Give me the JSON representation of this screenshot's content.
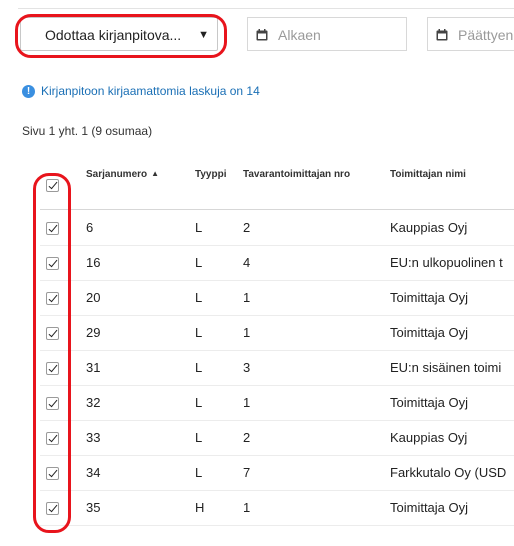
{
  "filters": {
    "status_value": "Odottaa kirjanpitova...",
    "start_placeholder": "Alkaen",
    "end_placeholder": "Päättyen"
  },
  "notice": {
    "text": "Kirjanpitoon kirjaamattomia laskuja on 14"
  },
  "pagination": {
    "text": "Sivu 1 yht. 1  (9 osumaa)"
  },
  "table": {
    "columns": [
      "Sarjanumero",
      "Tyyppi",
      "Tavarantoimittajan nro",
      "Toimittajan nimi"
    ],
    "sort_column": "Sarjanumero",
    "rows": [
      {
        "serial": "6",
        "type": "L",
        "supplier_no": "2",
        "supplier_name": "Kauppias Oyj",
        "checked": true
      },
      {
        "serial": "16",
        "type": "L",
        "supplier_no": "4",
        "supplier_name": "EU:n ulkopuolinen t",
        "checked": true
      },
      {
        "serial": "20",
        "type": "L",
        "supplier_no": "1",
        "supplier_name": "Toimittaja Oyj",
        "checked": true
      },
      {
        "serial": "29",
        "type": "L",
        "supplier_no": "1",
        "supplier_name": "Toimittaja Oyj",
        "checked": true
      },
      {
        "serial": "31",
        "type": "L",
        "supplier_no": "3",
        "supplier_name": "EU:n sisäinen toimi",
        "checked": true
      },
      {
        "serial": "32",
        "type": "L",
        "supplier_no": "1",
        "supplier_name": "Toimittaja Oyj",
        "checked": true
      },
      {
        "serial": "33",
        "type": "L",
        "supplier_no": "2",
        "supplier_name": "Kauppias Oyj",
        "checked": true
      },
      {
        "serial": "34",
        "type": "L",
        "supplier_no": "7",
        "supplier_name": "Farkkutalo Oy (USD",
        "checked": true
      },
      {
        "serial": "35",
        "type": "H",
        "supplier_no": "1",
        "supplier_name": "Toimittaja Oyj",
        "checked": true
      }
    ]
  },
  "colors": {
    "highlight": "#e8141c",
    "link": "#1a6fb5",
    "info_icon": "#3a8fe0"
  },
  "icons": {
    "date_icon": "calendar-icon",
    "notice_icon": "info-icon",
    "sort_icon": "sort-ascending-icon"
  }
}
